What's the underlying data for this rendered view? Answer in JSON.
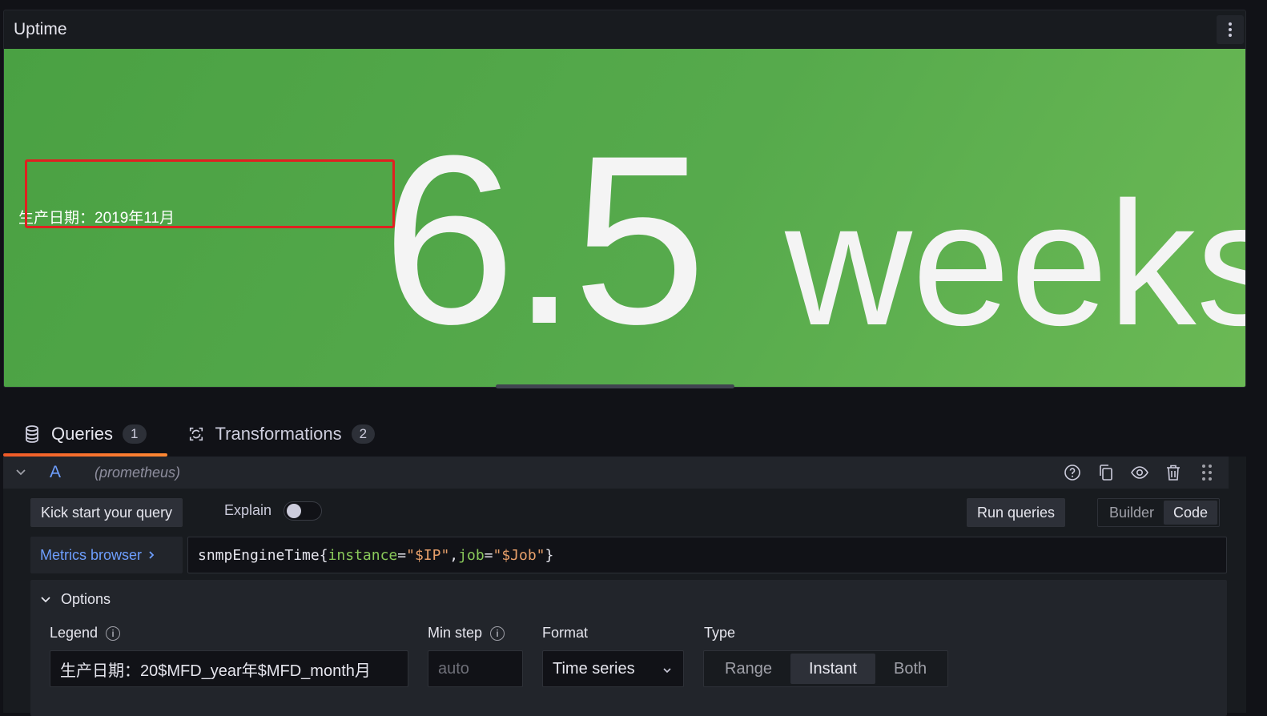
{
  "panel": {
    "title": "Uptime",
    "legend": "生产日期：2019年11月",
    "value": "6.5",
    "unit": "weeks",
    "background_color": "#56aa4c"
  },
  "tabs": [
    {
      "label": "Queries",
      "count": "1",
      "icon": "database-icon",
      "active": true
    },
    {
      "label": "Transformations",
      "count": "2",
      "icon": "transform-icon",
      "active": false
    }
  ],
  "query": {
    "ref_id": "A",
    "datasource": "(prometheus)",
    "actions": [
      "help-icon",
      "copy-icon",
      "eye-icon",
      "trash-icon",
      "drag-icon"
    ],
    "kick_start_label": "Kick start your query",
    "explain_label": "Explain",
    "explain_on": false,
    "run_queries_label": "Run queries",
    "editor_modes": [
      "Builder",
      "Code"
    ],
    "editor_mode_selected": "Code",
    "metrics_browser_label": "Metrics browser",
    "expr": {
      "metric": "snmpEngineTime",
      "open": "{",
      "label1": "instance",
      "eq1": "=",
      "val1": "\"$IP\"",
      "comma": ",",
      "label2": "job",
      "eq2": "=",
      "val2": "\"$Job\"",
      "close": "}"
    }
  },
  "options": {
    "title": "Options",
    "legend_label": "Legend",
    "legend_value": "生产日期：20$MFD_year年$MFD_month月",
    "min_step_label": "Min step",
    "min_step_placeholder": "auto",
    "format_label": "Format",
    "format_value": "Time series",
    "type_label": "Type",
    "type_options": [
      "Range",
      "Instant",
      "Both"
    ],
    "type_selected": "Instant"
  }
}
